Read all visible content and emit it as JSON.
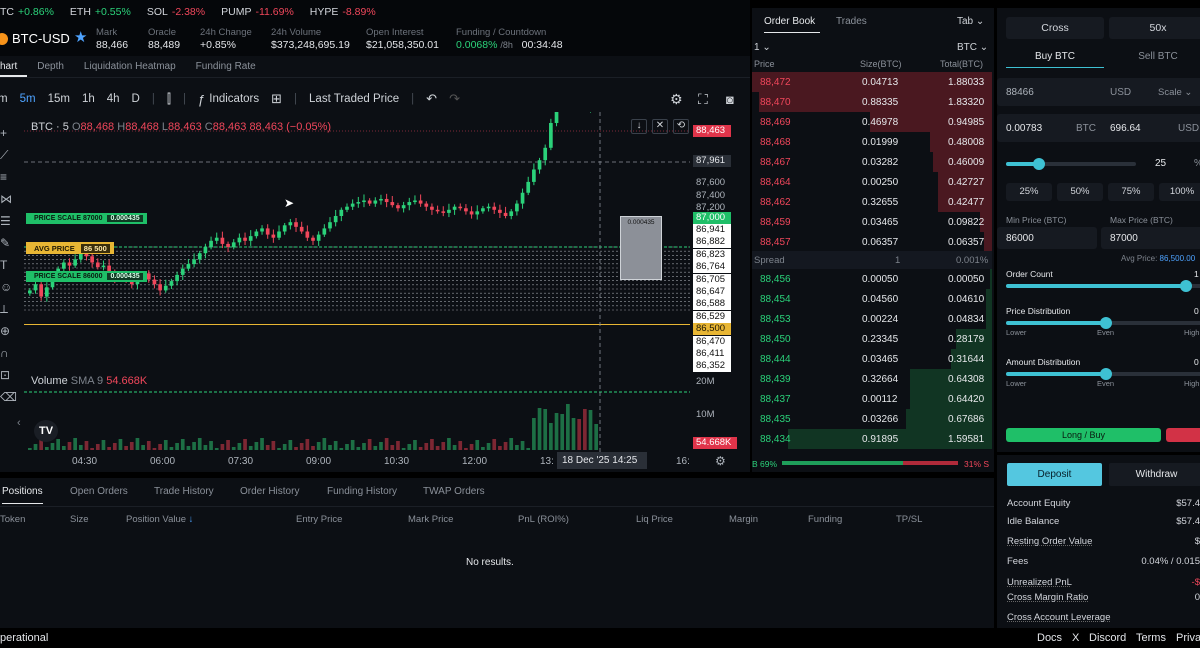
{
  "ticker": [
    {
      "sym": "TC",
      "chg": "+0.86%",
      "up": true
    },
    {
      "sym": "ETH",
      "chg": "+0.55%",
      "up": true
    },
    {
      "sym": "SOL",
      "chg": "-2.38%",
      "up": false
    },
    {
      "sym": "PUMP",
      "chg": "-11.69%",
      "up": false
    },
    {
      "sym": "HYPE",
      "chg": "-8.89%",
      "up": false
    }
  ],
  "market": {
    "pair": "BTC-USD",
    "stats": [
      {
        "label": "Mark",
        "value": "88,466"
      },
      {
        "label": "Oracle",
        "value": "88,489"
      },
      {
        "label": "24h Change",
        "value": "+0.85%"
      },
      {
        "label": "24h Volume",
        "value": "$373,248,695.19"
      },
      {
        "label": "Open Interest",
        "value": "$21,058,350.01"
      },
      {
        "label": "Funding / Countdown",
        "value": "0.0068%",
        "sub": "/8h",
        "countdown": "00:34:48"
      }
    ]
  },
  "chart_tabs": [
    "hart",
    "Depth",
    "Liquidation Heatmap",
    "Funding Rate"
  ],
  "toolbar": {
    "intervals": [
      "m",
      "5m",
      "15m",
      "1h",
      "4h",
      "D"
    ],
    "indicators": "Indicators",
    "price_source": "Last Traded Price"
  },
  "chart": {
    "legend": {
      "symbol": "BTC · 5",
      "o_lbl": "O",
      "o": "88,468",
      "h_lbl": "H",
      "h": "88,468",
      "l_lbl": "L",
      "l": "88,463",
      "c_lbl": "C",
      "c": "88,463",
      "chg": "88,463 (−0.05%)"
    },
    "volume_label": "Volume",
    "volume_sma": "SMA 9",
    "volume_value": "54.668K",
    "last_price_tag": "88,463",
    "crosshair_price": "87,961",
    "price_ticks": [
      "87,600",
      "87,400",
      "87,200"
    ],
    "avg_price_tag": "87,000",
    "grid_levels": [
      "86,941",
      "86,882",
      "86,823",
      "86,764",
      "86,705",
      "86,647",
      "86,588",
      "86,529",
      "86,500",
      "86,470",
      "86,411",
      "86,352"
    ],
    "vol_ticks": [
      "20M",
      "10M"
    ],
    "vol_tag": "54.668K",
    "time_ticks": [
      "04:30",
      "06:00",
      "07:30",
      "09:00",
      "10:30",
      "12:00",
      "13:",
      "16:"
    ],
    "crosshair_time": "18 Dec '25   14:25",
    "labels": {
      "scale_top": "PRICE SCALE 87000",
      "scale_top_qty": "0.000435",
      "avg": "AVG PRICE",
      "avg_val": "86 500",
      "scale_bot": "PRICE SCALE 86000",
      "scale_bot_qty": "0.000435",
      "box_qty": "0.000435"
    },
    "colors": {
      "up": "#2bd27a",
      "down": "#f0475b",
      "grid": "#c9ced6",
      "avg": "#e8b634"
    }
  },
  "chart_data": {
    "type": "candlestick",
    "x_ticks": [
      "04:30",
      "06:00",
      "07:30",
      "09:00",
      "10:30",
      "12:00",
      "13:",
      "16:"
    ],
    "y_ticks": [
      "87,600",
      "87,400",
      "87,200"
    ],
    "close_series": [
      86720,
      86760,
      86680,
      86740,
      86800,
      86860,
      86900,
      86880,
      86920,
      86960,
      86940,
      86900,
      86870,
      86880,
      86840,
      86800,
      86820,
      86790,
      86760,
      86800,
      86830,
      86790,
      86760,
      86720,
      86750,
      86780,
      86820,
      86860,
      86890,
      86920,
      86960,
      87000,
      87040,
      87060,
      87020,
      87000,
      87030,
      87060,
      87040,
      87070,
      87100,
      87120,
      87080,
      87060,
      87100,
      87140,
      87160,
      87130,
      87100,
      87060,
      87040,
      87080,
      87120,
      87160,
      87200,
      87240,
      87260,
      87280,
      87290,
      87300,
      87280,
      87300,
      87310,
      87290,
      87270,
      87250,
      87270,
      87290,
      87300,
      87280,
      87260,
      87240,
      87230,
      87220,
      87240,
      87260,
      87250,
      87230,
      87210,
      87230,
      87250,
      87260,
      87240,
      87220,
      87200,
      87230,
      87280,
      87350,
      87420,
      87500,
      87560,
      87640,
      87800,
      88000,
      88200,
      88380,
      88460,
      88300,
      87900,
      88000,
      88463
    ]
  },
  "orderbook": {
    "tabs": [
      "Order Book",
      "Trades"
    ],
    "tab_menu": "Tab",
    "group": "1",
    "unit": "BTC",
    "headers": [
      "Price",
      "Size(BTC)",
      "Total(BTC)"
    ],
    "asks": [
      [
        "88,472",
        "0.04713",
        "1.88033",
        1.0
      ],
      [
        "88,470",
        "0.88335",
        "1.83320",
        0.97
      ],
      [
        "88,469",
        "0.46978",
        "0.94985",
        0.51
      ],
      [
        "88,468",
        "0.01999",
        "0.48008",
        0.26
      ],
      [
        "88,467",
        "0.03282",
        "0.46009",
        0.245
      ],
      [
        "88,464",
        "0.00250",
        "0.42727",
        0.227
      ],
      [
        "88,462",
        "0.32655",
        "0.42477",
        0.226
      ],
      [
        "88,459",
        "0.03465",
        "0.09822",
        0.052
      ],
      [
        "88,457",
        "0.06357",
        "0.06357",
        0.034
      ]
    ],
    "spread": {
      "label": "Spread",
      "value": "1",
      "pct": "0.001%"
    },
    "bids": [
      [
        "88,456",
        "0.00050",
        "0.00050",
        0.0003
      ],
      [
        "88,454",
        "0.04560",
        "0.04610",
        0.025
      ],
      [
        "88,453",
        "0.00224",
        "0.04834",
        0.026
      ],
      [
        "88,450",
        "0.23345",
        "0.28179",
        0.15
      ],
      [
        "88,444",
        "0.03465",
        "0.31644",
        0.17
      ],
      [
        "88,439",
        "0.32664",
        "0.64308",
        0.34
      ],
      [
        "88,437",
        "0.00112",
        "0.64420",
        0.34
      ],
      [
        "88,435",
        "0.03266",
        "0.67686",
        0.36
      ],
      [
        "88,434",
        "0.91895",
        "1.59581",
        0.85
      ]
    ],
    "ratio_bid": "B 69%",
    "ratio_ask": "31% S",
    "ratio_fraction": 0.69
  },
  "trade": {
    "margin_mode": "Cross",
    "leverage": "50x",
    "buy": "Buy BTC",
    "sell": "Sell BTC",
    "price": "88466",
    "price_unit": "USD",
    "scale": "Scale",
    "size_btc": "0.00783",
    "size_btc_unit": "BTC",
    "size_usd": "696.64",
    "size_usd_unit": "USD",
    "size_pct_value": "25",
    "size_pct_fraction": 0.25,
    "size_pct_sym": "%",
    "quick": [
      "25%",
      "50%",
      "75%",
      "100%"
    ],
    "min_label": "Min Price (BTC)",
    "max_label": "Max Price (BTC)",
    "min_value": "86000",
    "max_value": "87000",
    "avg_price_label": "Avg Price:",
    "avg_price_value": "86,500.00",
    "order_count_label": "Order Count",
    "order_count_value": "1",
    "order_count_fraction": 0.9,
    "price_dist_label": "Price Distribution",
    "price_dist_fraction": 0.5,
    "amount_dist_label": "Amount Distribution",
    "amount_dist_fraction": 0.5,
    "slider_lo": "Lower",
    "slider_mid": "Even",
    "slider_hi": "High",
    "slider_zero": "0",
    "submit": "Long / Buy"
  },
  "account": {
    "deposit": "Deposit",
    "withdraw": "Withdraw",
    "rows": [
      [
        "Account Equity",
        "$57.4"
      ],
      [
        "Idle Balance",
        "$57.4"
      ],
      [
        "Resting Order Value",
        "$"
      ],
      [
        "Fees",
        "0.04% / 0.015"
      ],
      [
        "Unrealized PnL",
        "-$"
      ],
      [
        "Cross Margin Ratio",
        "0"
      ],
      [
        "Cross Account Leverage",
        ""
      ]
    ]
  },
  "positions": {
    "tabs": [
      "Positions",
      "Open Orders",
      "Trade History",
      "Order History",
      "Funding History",
      "TWAP Orders"
    ],
    "columns": [
      "Token",
      "Size",
      "Position Value",
      "Entry Price",
      "Mark Price",
      "PnL (ROI%)",
      "Liq Price",
      "Margin",
      "Funding",
      "TP/SL"
    ],
    "empty": "No results."
  },
  "footer": {
    "status": "perational",
    "links": [
      "Docs",
      "X",
      "Discord",
      "Terms",
      "Priva"
    ]
  }
}
